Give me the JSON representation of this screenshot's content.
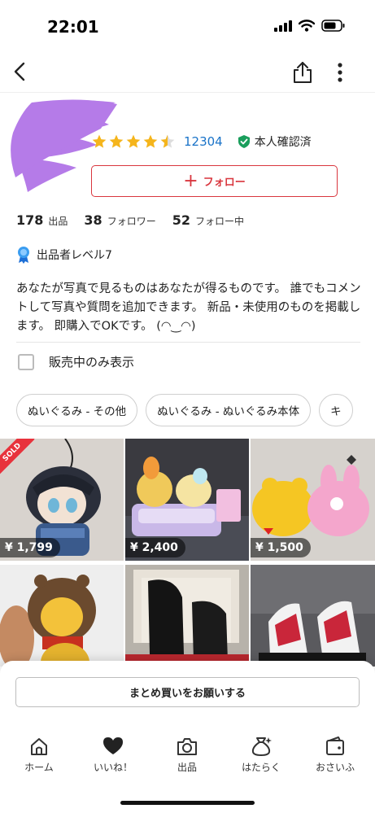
{
  "status_bar": {
    "time": "22:01"
  },
  "nav": {
    "back_icon": "chevron-left-icon",
    "share_icon": "share-icon",
    "more_icon": "more-vertical-icon"
  },
  "profile": {
    "rating": 4.5,
    "rating_count": "12304",
    "verified_label": "本人確認済",
    "follow_label": "フォロー",
    "stats": [
      {
        "value": "178",
        "label": "出品"
      },
      {
        "value": "38",
        "label": "フォロワー"
      },
      {
        "value": "52",
        "label": "フォロー中"
      }
    ],
    "level_label": "出品者レベル7",
    "bio": "あなたが写真で見るものはあなたが得るものです。 誰でもコメントして写真や質問を追加できます。 新品・未使用のものを掲載します。 即購入でOKです。 (◠‿◠)"
  },
  "filter": {
    "on_sale_label": "販売中のみ表示",
    "checked": false
  },
  "chips": [
    "ぬいぐるみ - その他",
    "ぬいぐるみ - ぬいぐるみ本体",
    "キ"
  ],
  "items": [
    {
      "price": "¥ 1,799",
      "sold": true,
      "sold_label": "SOLD"
    },
    {
      "price": "¥ 2,400",
      "sold": false
    },
    {
      "price": "¥ 1,500",
      "sold": false
    },
    {
      "price": "",
      "sold": false
    },
    {
      "price": "",
      "sold": false
    },
    {
      "price": "",
      "sold": false
    }
  ],
  "bulk_button_label": "まとめ買いをお願いする",
  "tabs": [
    {
      "label": "ホーム",
      "icon": "home-icon"
    },
    {
      "label": "いいね！",
      "icon": "heart-icon"
    },
    {
      "label": "出品",
      "icon": "camera-icon"
    },
    {
      "label": "はたらく",
      "icon": "money-bag-icon"
    },
    {
      "label": "おさいふ",
      "icon": "wallet-icon"
    }
  ],
  "colors": {
    "accent_red": "#d9363e",
    "link_blue": "#1a73c8",
    "star": "#f5b51c",
    "verified_green": "#1a9e5c",
    "avatar_scribble": "#b57be8"
  }
}
